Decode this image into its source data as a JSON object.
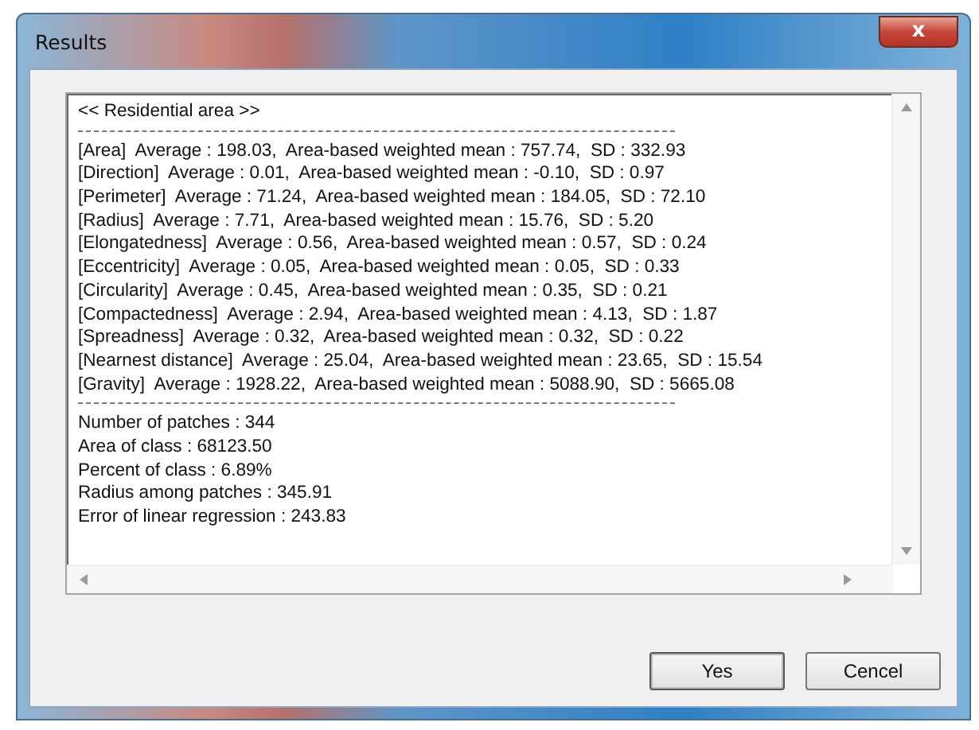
{
  "window": {
    "title": "Results",
    "close_symbol": "x"
  },
  "report": {
    "heading": "<< Residential area >>",
    "measures": [
      "[Area]  Average : 198.03,  Area-based weighted mean : 757.74,  SD : 332.93",
      "[Direction]  Average : 0.01,  Area-based weighted mean : -0.10,  SD : 0.97",
      "[Perimeter]  Average : 71.24,  Area-based weighted mean : 184.05,  SD : 72.10",
      "[Radius]  Average : 7.71,  Area-based weighted mean : 15.76,  SD : 5.20",
      "[Elongatedness]  Average : 0.56,  Area-based weighted mean : 0.57,  SD : 0.24",
      "[Eccentricity]  Average : 0.05,  Area-based weighted mean : 0.05,  SD : 0.33",
      "[Circularity]  Average : 0.45,  Area-based weighted mean : 0.35,  SD : 0.21",
      "[Compactedness]  Average : 2.94,  Area-based weighted mean : 4.13,  SD : 1.87",
      "[Spreadness]  Average : 0.32,  Area-based weighted mean : 0.32,  SD : 0.22",
      "[Nearnest distance]  Average : 25.04,  Area-based weighted mean : 23.65,  SD : 15.54",
      "[Gravity]  Average : 1928.22,  Area-based weighted mean : 5088.90,  SD : 5665.08"
    ],
    "summary": [
      "Number of patches : 344",
      "Area of class : 68123.50",
      "Percent of class : 6.89%",
      "Radius among patches : 345.91",
      "Error of linear regression : 243.83"
    ]
  },
  "buttons": [
    "Yes",
    "Cencel"
  ]
}
